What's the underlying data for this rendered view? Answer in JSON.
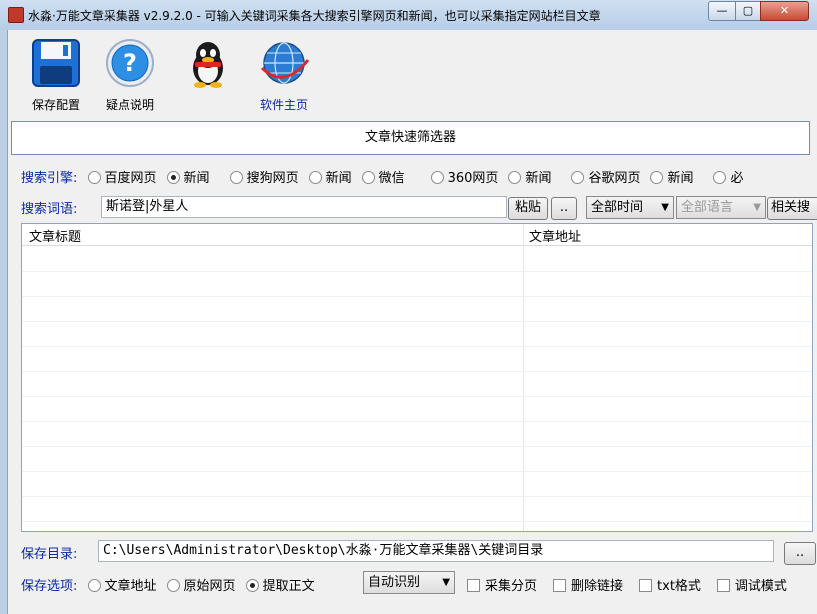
{
  "window": {
    "title": "水淼·万能文章采集器 v2.9.2.0 - 可输入关键词采集各大搜索引擎网页和新闻，也可以采集指定网站栏目文章",
    "min_icon": "minimize-icon",
    "max_icon": "maximize-icon",
    "close_icon": "close-icon",
    "min_glyph": "—",
    "max_glyph": "▢",
    "close_glyph": "✕"
  },
  "toolbar": {
    "save_config": "保存配置",
    "help": "疑点说明",
    "qq": "",
    "homepage": "软件主页"
  },
  "filter": {
    "label": "文章快速筛选器"
  },
  "engine": {
    "label": "搜索引擎:",
    "options": [
      {
        "label": "百度网页",
        "checked": false
      },
      {
        "label": "新闻",
        "checked": true
      },
      {
        "label": "搜狗网页",
        "checked": false
      },
      {
        "label": "新闻",
        "checked": false
      },
      {
        "label": "微信",
        "checked": false
      },
      {
        "label": "360网页",
        "checked": false
      },
      {
        "label": "新闻",
        "checked": false
      },
      {
        "label": "谷歌网页",
        "checked": false
      },
      {
        "label": "新闻",
        "checked": false
      },
      {
        "label": "必",
        "checked": false
      }
    ]
  },
  "keyword": {
    "label": "搜索词语:",
    "value": "斯诺登|外星人",
    "paste_button": "粘贴",
    "browse_button": "..",
    "time_select": "全部时间",
    "lang_select": "全部语言",
    "related_button": "相关搜"
  },
  "results": {
    "col_title": "文章标题",
    "col_url": "文章地址",
    "rows": []
  },
  "save_dir": {
    "label": "保存目录:",
    "value": "C:\\Users\\Administrator\\Desktop\\水淼·万能文章采集器\\关键词目录",
    "browse_button": ".."
  },
  "save_options": {
    "label": "保存选项:",
    "radios": [
      {
        "label": "文章地址",
        "checked": false
      },
      {
        "label": "原始网页",
        "checked": false
      },
      {
        "label": "提取正文",
        "checked": true
      }
    ],
    "mode_select": "自动识别",
    "checks": [
      {
        "label": "采集分页",
        "checked": false
      },
      {
        "label": "删除链接",
        "checked": false
      },
      {
        "label": "txt格式",
        "checked": false
      },
      {
        "label": "调试模式",
        "checked": false
      }
    ]
  }
}
